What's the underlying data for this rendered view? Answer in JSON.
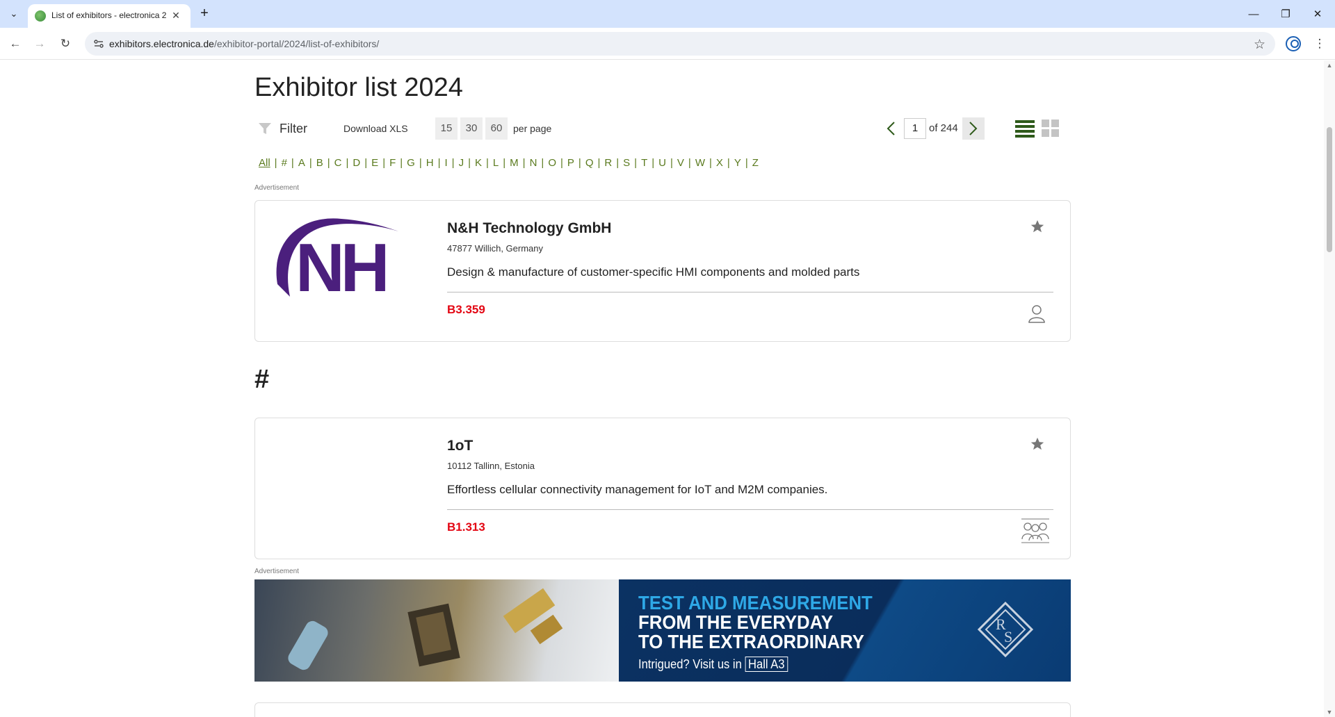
{
  "browser": {
    "tab_title": "List of exhibitors - electronica 2",
    "url_host": "exhibitors.electronica.de",
    "url_path": "/exhibitor-portal/2024/list-of-exhibitors/"
  },
  "page": {
    "title": "Exhibitor list 2024",
    "controls": {
      "filter_label": "Filter",
      "download_label": "Download XLS",
      "per_page_options": [
        "15",
        "30",
        "60"
      ],
      "per_page_label": "per page",
      "current_page": "1",
      "total_pages_label": "of 244"
    },
    "alphabet": [
      "All",
      "#",
      "A",
      "B",
      "C",
      "D",
      "E",
      "F",
      "G",
      "H",
      "I",
      "J",
      "K",
      "L",
      "M",
      "N",
      "O",
      "P",
      "Q",
      "R",
      "S",
      "T",
      "U",
      "V",
      "W",
      "X",
      "Y",
      "Z"
    ],
    "advertisement_label": "Advertisement",
    "section_heading": "#",
    "featured_exhibitor": {
      "logo_text": "NH",
      "name": "N&H Technology GmbH",
      "location": "47877 Willich, Germany",
      "description": "Design & manufacture of customer-specific HMI components and molded parts",
      "booth": "B3.359"
    },
    "exhibitors": [
      {
        "name": "1oT",
        "location": "10112 Tallinn, Estonia",
        "description": "Effortless cellular connectivity management for IoT and M2M companies.",
        "booth": "B1.313"
      }
    ],
    "banner": {
      "line1": "TEST AND MEASUREMENT",
      "line2": "FROM THE EVERYDAY",
      "line3": "TO THE EXTRAORDINARY",
      "line4_prefix": "Intrigued? Visit us in",
      "line4_hall": "Hall A3"
    }
  },
  "colors": {
    "accent_green": "#5a7a1e",
    "booth_red": "#e30613",
    "banner_blue": "#0b3263",
    "banner_cyan": "#2ea8e6",
    "nh_purple": "#4b1f7d"
  }
}
